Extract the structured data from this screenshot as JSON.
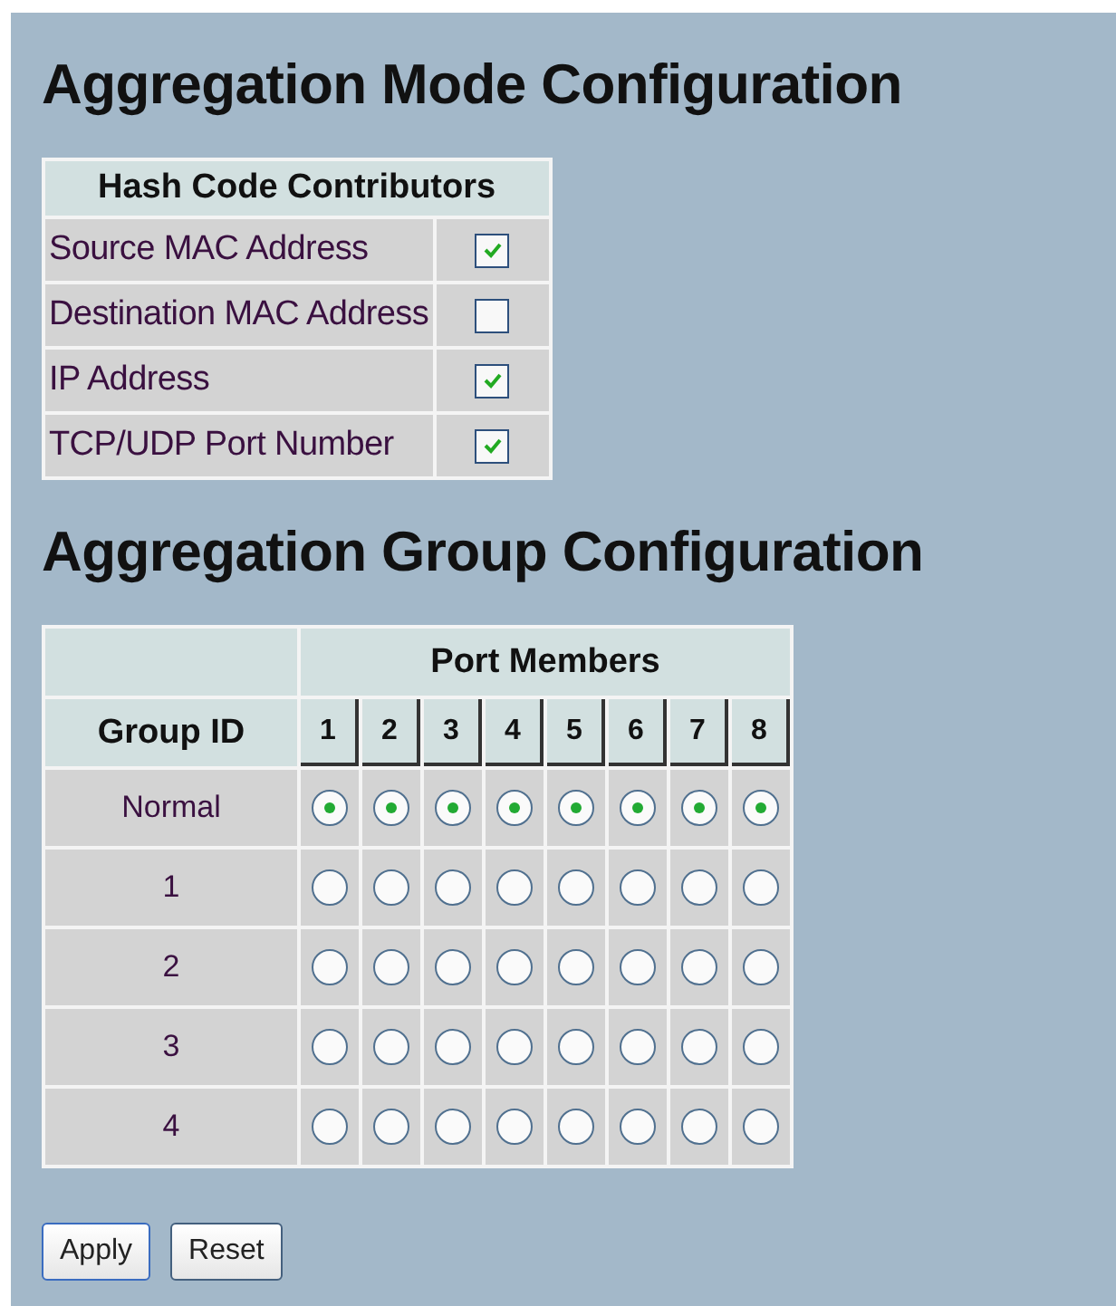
{
  "mode_section": {
    "title": "Aggregation Mode Configuration",
    "table": {
      "header": "Hash Code Contributors",
      "rows": [
        {
          "label": "Source MAC Address",
          "checked": true
        },
        {
          "label": "Destination MAC Address",
          "checked": false
        },
        {
          "label": "IP Address",
          "checked": true
        },
        {
          "label": "TCP/UDP Port Number",
          "checked": true
        }
      ]
    }
  },
  "group_section": {
    "title": "Aggregation Group Configuration",
    "table": {
      "port_members_header": "Port Members",
      "group_id_header": "Group ID",
      "ports": [
        "1",
        "2",
        "3",
        "4",
        "5",
        "6",
        "7",
        "8"
      ],
      "rows": [
        {
          "group": "Normal",
          "members": [
            {
              "selected": true
            },
            {
              "selected": true
            },
            {
              "selected": true
            },
            {
              "selected": true
            },
            {
              "selected": true
            },
            {
              "selected": true
            },
            {
              "selected": true
            },
            {
              "selected": true
            }
          ]
        },
        {
          "group": "1",
          "members": [
            {
              "selected": false
            },
            {
              "selected": false
            },
            {
              "selected": false
            },
            {
              "selected": false
            },
            {
              "selected": false
            },
            {
              "selected": false
            },
            {
              "selected": false
            },
            {
              "selected": false
            }
          ]
        },
        {
          "group": "2",
          "members": [
            {
              "selected": false
            },
            {
              "selected": false
            },
            {
              "selected": false
            },
            {
              "selected": false
            },
            {
              "selected": false
            },
            {
              "selected": false
            },
            {
              "selected": false
            },
            {
              "selected": false
            }
          ]
        },
        {
          "group": "3",
          "members": [
            {
              "selected": false
            },
            {
              "selected": false
            },
            {
              "selected": false
            },
            {
              "selected": false
            },
            {
              "selected": false
            },
            {
              "selected": false
            },
            {
              "selected": false
            },
            {
              "selected": false
            }
          ]
        },
        {
          "group": "4",
          "members": [
            {
              "selected": false
            },
            {
              "selected": false
            },
            {
              "selected": false
            },
            {
              "selected": false
            },
            {
              "selected": false
            },
            {
              "selected": false
            },
            {
              "selected": false
            },
            {
              "selected": false
            }
          ]
        }
      ]
    }
  },
  "buttons": [
    "Apply",
    "Reset"
  ]
}
